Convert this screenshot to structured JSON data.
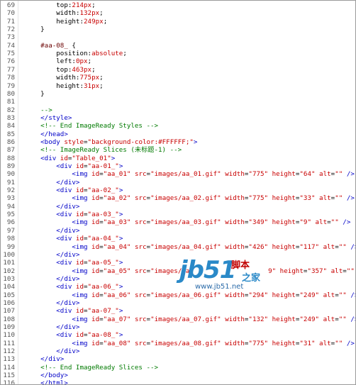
{
  "editor": {
    "lines": [
      {
        "n": "69",
        "parts": [
          [
            "p",
            "        "
          ],
          [
            "p",
            "top"
          ],
          [
            "p",
            ":"
          ],
          [
            "s",
            "214px"
          ],
          [
            "p",
            ";"
          ]
        ]
      },
      {
        "n": "70",
        "parts": [
          [
            "p",
            "        "
          ],
          [
            "p",
            "width"
          ],
          [
            "p",
            ":"
          ],
          [
            "s",
            "132px"
          ],
          [
            "p",
            ";"
          ]
        ]
      },
      {
        "n": "71",
        "parts": [
          [
            "p",
            "        "
          ],
          [
            "p",
            "height"
          ],
          [
            "p",
            ":"
          ],
          [
            "s",
            "249px"
          ],
          [
            "p",
            ";"
          ]
        ]
      },
      {
        "n": "72",
        "parts": [
          [
            "p",
            "    }"
          ]
        ]
      },
      {
        "n": "73",
        "parts": []
      },
      {
        "n": "74",
        "parts": [
          [
            "sel",
            "    #aa-08_ "
          ],
          [
            "p",
            "{"
          ]
        ]
      },
      {
        "n": "75",
        "parts": [
          [
            "p",
            "        position"
          ],
          [
            "p",
            ":"
          ],
          [
            "s",
            "absolute"
          ],
          [
            "p",
            ";"
          ]
        ]
      },
      {
        "n": "76",
        "parts": [
          [
            "p",
            "        left"
          ],
          [
            "p",
            ":"
          ],
          [
            "s",
            "0px"
          ],
          [
            "p",
            ";"
          ]
        ]
      },
      {
        "n": "77",
        "parts": [
          [
            "p",
            "        top"
          ],
          [
            "p",
            ":"
          ],
          [
            "s",
            "463px"
          ],
          [
            "p",
            ";"
          ]
        ]
      },
      {
        "n": "78",
        "parts": [
          [
            "p",
            "        width"
          ],
          [
            "p",
            ":"
          ],
          [
            "s",
            "775px"
          ],
          [
            "p",
            ";"
          ]
        ]
      },
      {
        "n": "79",
        "parts": [
          [
            "p",
            "        height"
          ],
          [
            "p",
            ":"
          ],
          [
            "s",
            "31px"
          ],
          [
            "p",
            ";"
          ]
        ]
      },
      {
        "n": "80",
        "parts": [
          [
            "p",
            "    }"
          ]
        ]
      },
      {
        "n": "81",
        "parts": []
      },
      {
        "n": "82",
        "parts": [
          [
            "c",
            "    -->"
          ]
        ]
      },
      {
        "n": "83",
        "parts": [
          [
            "t",
            "    </style>"
          ]
        ]
      },
      {
        "n": "84",
        "parts": [
          [
            "c",
            "    <!-- End ImageReady Styles -->"
          ]
        ]
      },
      {
        "n": "85",
        "parts": [
          [
            "t",
            "    </head>"
          ]
        ]
      },
      {
        "n": "86",
        "parts": [
          [
            "t",
            "    <body "
          ],
          [
            "a",
            "style"
          ],
          [
            "p",
            "="
          ],
          [
            "s",
            "\"background-color:#FFFFFF;\""
          ],
          [
            "t",
            ">"
          ]
        ]
      },
      {
        "n": "87",
        "parts": [
          [
            "c",
            "    <!-- ImageReady Slices (未标题-1) -->"
          ]
        ]
      },
      {
        "n": "88",
        "parts": [
          [
            "t",
            "    <div "
          ],
          [
            "a",
            "id"
          ],
          [
            "p",
            "="
          ],
          [
            "s",
            "\"Table_01\""
          ],
          [
            "t",
            ">"
          ]
        ]
      },
      {
        "n": "89",
        "parts": [
          [
            "t",
            "        <div "
          ],
          [
            "a",
            "id"
          ],
          [
            "p",
            "="
          ],
          [
            "s",
            "\"aa-01_\""
          ],
          [
            "t",
            ">"
          ]
        ]
      },
      {
        "n": "90",
        "parts": [
          [
            "t",
            "            <img "
          ],
          [
            "a",
            "id"
          ],
          [
            "p",
            "="
          ],
          [
            "s",
            "\"aa_01\" "
          ],
          [
            "a",
            "src"
          ],
          [
            "p",
            "="
          ],
          [
            "s",
            "\"images/aa_01.gif\" "
          ],
          [
            "a",
            "width"
          ],
          [
            "p",
            "="
          ],
          [
            "s",
            "\"775\" "
          ],
          [
            "a",
            "height"
          ],
          [
            "p",
            "="
          ],
          [
            "s",
            "\"64\" "
          ],
          [
            "a",
            "alt"
          ],
          [
            "p",
            "="
          ],
          [
            "s",
            "\"\" "
          ],
          [
            "t",
            "/>"
          ]
        ]
      },
      {
        "n": "91",
        "parts": [
          [
            "t",
            "        </div>"
          ]
        ]
      },
      {
        "n": "92",
        "parts": [
          [
            "t",
            "        <div "
          ],
          [
            "a",
            "id"
          ],
          [
            "p",
            "="
          ],
          [
            "s",
            "\"aa-02_\""
          ],
          [
            "t",
            ">"
          ]
        ]
      },
      {
        "n": "93",
        "parts": [
          [
            "t",
            "            <img "
          ],
          [
            "a",
            "id"
          ],
          [
            "p",
            "="
          ],
          [
            "s",
            "\"aa_02\" "
          ],
          [
            "a",
            "src"
          ],
          [
            "p",
            "="
          ],
          [
            "s",
            "\"images/aa_02.gif\" "
          ],
          [
            "a",
            "width"
          ],
          [
            "p",
            "="
          ],
          [
            "s",
            "\"775\" "
          ],
          [
            "a",
            "height"
          ],
          [
            "p",
            "="
          ],
          [
            "s",
            "\"33\" "
          ],
          [
            "a",
            "alt"
          ],
          [
            "p",
            "="
          ],
          [
            "s",
            "\"\" "
          ],
          [
            "t",
            "/>"
          ]
        ]
      },
      {
        "n": "94",
        "parts": [
          [
            "t",
            "        </div>"
          ]
        ]
      },
      {
        "n": "95",
        "parts": [
          [
            "t",
            "        <div "
          ],
          [
            "a",
            "id"
          ],
          [
            "p",
            "="
          ],
          [
            "s",
            "\"aa-03_\""
          ],
          [
            "t",
            ">"
          ]
        ]
      },
      {
        "n": "96",
        "parts": [
          [
            "t",
            "            <img "
          ],
          [
            "a",
            "id"
          ],
          [
            "p",
            "="
          ],
          [
            "s",
            "\"aa_03\" "
          ],
          [
            "a",
            "src"
          ],
          [
            "p",
            "="
          ],
          [
            "s",
            "\"images/aa_03.gif\" "
          ],
          [
            "a",
            "width"
          ],
          [
            "p",
            "="
          ],
          [
            "s",
            "\"349\" "
          ],
          [
            "a",
            "height"
          ],
          [
            "p",
            "="
          ],
          [
            "s",
            "\"9\" "
          ],
          [
            "a",
            "alt"
          ],
          [
            "p",
            "="
          ],
          [
            "s",
            "\"\" "
          ],
          [
            "t",
            "/>"
          ]
        ]
      },
      {
        "n": "97",
        "parts": [
          [
            "t",
            "        </div>"
          ]
        ]
      },
      {
        "n": "98",
        "parts": [
          [
            "t",
            "        <div "
          ],
          [
            "a",
            "id"
          ],
          [
            "p",
            "="
          ],
          [
            "s",
            "\"aa-04_\""
          ],
          [
            "t",
            ">"
          ]
        ]
      },
      {
        "n": "99",
        "parts": [
          [
            "t",
            "            <img "
          ],
          [
            "a",
            "id"
          ],
          [
            "p",
            "="
          ],
          [
            "s",
            "\"aa_04\" "
          ],
          [
            "a",
            "src"
          ],
          [
            "p",
            "="
          ],
          [
            "s",
            "\"images/aa_04.gif\" "
          ],
          [
            "a",
            "width"
          ],
          [
            "p",
            "="
          ],
          [
            "s",
            "\"426\" "
          ],
          [
            "a",
            "height"
          ],
          [
            "p",
            "="
          ],
          [
            "s",
            "\"117\" "
          ],
          [
            "a",
            "alt"
          ],
          [
            "p",
            "="
          ],
          [
            "s",
            "\"\" "
          ],
          [
            "t",
            "/>"
          ]
        ]
      },
      {
        "n": "100",
        "parts": [
          [
            "t",
            "        </div>"
          ]
        ]
      },
      {
        "n": "101",
        "parts": [
          [
            "t",
            "        <div "
          ],
          [
            "a",
            "id"
          ],
          [
            "p",
            "="
          ],
          [
            "s",
            "\"aa-05_\""
          ],
          [
            "t",
            ">"
          ]
        ]
      },
      {
        "n": "102",
        "parts": [
          [
            "t",
            "            <img "
          ],
          [
            "a",
            "id"
          ],
          [
            "p",
            "="
          ],
          [
            "s",
            "\"aa_05\" "
          ],
          [
            "a",
            "src"
          ],
          [
            "p",
            "="
          ],
          [
            "s",
            "\"images/aa_"
          ],
          [
            "p",
            "                   "
          ],
          [
            "s",
            "9\" "
          ],
          [
            "a",
            "height"
          ],
          [
            "p",
            "="
          ],
          [
            "s",
            "\"357\" "
          ],
          [
            "a",
            "alt"
          ],
          [
            "p",
            "="
          ],
          [
            "s",
            "\"\" "
          ],
          [
            "t",
            "/>"
          ]
        ]
      },
      {
        "n": "103",
        "parts": [
          [
            "t",
            "        </div>"
          ]
        ]
      },
      {
        "n": "104",
        "parts": [
          [
            "t",
            "        <div "
          ],
          [
            "a",
            "id"
          ],
          [
            "p",
            "="
          ],
          [
            "s",
            "\"aa-06_\""
          ],
          [
            "t",
            ">"
          ]
        ]
      },
      {
        "n": "105",
        "parts": [
          [
            "t",
            "            <img "
          ],
          [
            "a",
            "id"
          ],
          [
            "p",
            "="
          ],
          [
            "s",
            "\"aa_06\" "
          ],
          [
            "a",
            "src"
          ],
          [
            "p",
            "="
          ],
          [
            "s",
            "\"images/aa_06.gif\" "
          ],
          [
            "a",
            "width"
          ],
          [
            "p",
            "="
          ],
          [
            "s",
            "\"294\" "
          ],
          [
            "a",
            "height"
          ],
          [
            "p",
            "="
          ],
          [
            "s",
            "\"249\" "
          ],
          [
            "a",
            "alt"
          ],
          [
            "p",
            "="
          ],
          [
            "s",
            "\"\" "
          ],
          [
            "t",
            "/>"
          ]
        ]
      },
      {
        "n": "106",
        "parts": [
          [
            "t",
            "        </div>"
          ]
        ]
      },
      {
        "n": "107",
        "parts": [
          [
            "t",
            "        <div "
          ],
          [
            "a",
            "id"
          ],
          [
            "p",
            "="
          ],
          [
            "s",
            "\"aa-07_\""
          ],
          [
            "t",
            ">"
          ]
        ]
      },
      {
        "n": "108",
        "parts": [
          [
            "t",
            "            <img "
          ],
          [
            "a",
            "id"
          ],
          [
            "p",
            "="
          ],
          [
            "s",
            "\"aa_07\" "
          ],
          [
            "a",
            "src"
          ],
          [
            "p",
            "="
          ],
          [
            "s",
            "\"images/aa_07.gif\" "
          ],
          [
            "a",
            "width"
          ],
          [
            "p",
            "="
          ],
          [
            "s",
            "\"132\" "
          ],
          [
            "a",
            "height"
          ],
          [
            "p",
            "="
          ],
          [
            "s",
            "\"249\" "
          ],
          [
            "a",
            "alt"
          ],
          [
            "p",
            "="
          ],
          [
            "s",
            "\"\" "
          ],
          [
            "t",
            "/>"
          ]
        ]
      },
      {
        "n": "109",
        "parts": [
          [
            "t",
            "        </div>"
          ]
        ]
      },
      {
        "n": "110",
        "parts": [
          [
            "t",
            "        <div "
          ],
          [
            "a",
            "id"
          ],
          [
            "p",
            "="
          ],
          [
            "s",
            "\"aa-08_\""
          ],
          [
            "t",
            ">"
          ]
        ]
      },
      {
        "n": "111",
        "parts": [
          [
            "t",
            "            <img "
          ],
          [
            "a",
            "id"
          ],
          [
            "p",
            "="
          ],
          [
            "s",
            "\"aa_08\" "
          ],
          [
            "a",
            "src"
          ],
          [
            "p",
            "="
          ],
          [
            "s",
            "\"images/aa_08.gif\" "
          ],
          [
            "a",
            "width"
          ],
          [
            "p",
            "="
          ],
          [
            "s",
            "\"775\" "
          ],
          [
            "a",
            "height"
          ],
          [
            "p",
            "="
          ],
          [
            "s",
            "\"31\" "
          ],
          [
            "a",
            "alt"
          ],
          [
            "p",
            "="
          ],
          [
            "s",
            "\"\" "
          ],
          [
            "t",
            "/>"
          ]
        ]
      },
      {
        "n": "112",
        "parts": [
          [
            "t",
            "        </div>"
          ]
        ]
      },
      {
        "n": "113",
        "parts": [
          [
            "t",
            "    </div>"
          ]
        ]
      },
      {
        "n": "114",
        "parts": [
          [
            "c",
            "    <!-- End ImageReady Slices -->"
          ]
        ]
      },
      {
        "n": "115",
        "parts": [
          [
            "t",
            "    </body>"
          ]
        ]
      },
      {
        "n": "116",
        "parts": [
          [
            "t",
            "    </html>"
          ]
        ]
      }
    ]
  },
  "watermark": {
    "logo": "jb51",
    "cn_line1": "脚本",
    "cn_line2": "之家",
    "url": "www.jb51.net"
  },
  "colors": {
    "tag": "#0000c8",
    "attr": "#c80000",
    "comment": "#007a00",
    "line_number": "#555555"
  }
}
